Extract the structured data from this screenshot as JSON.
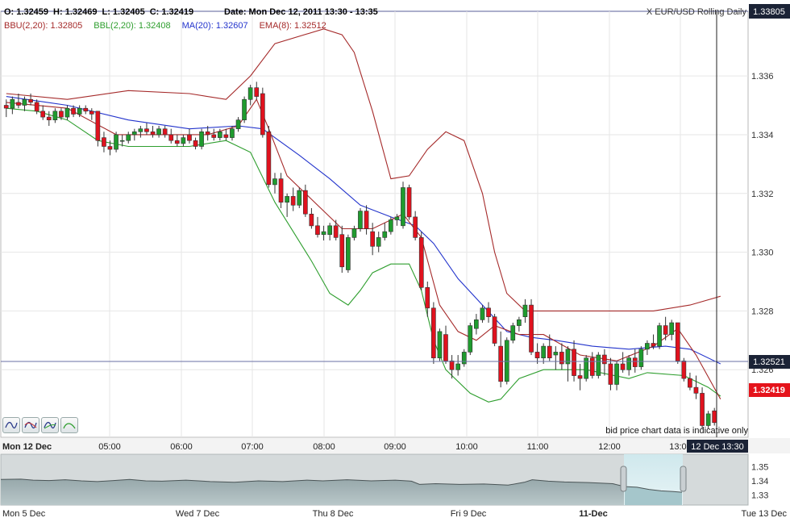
{
  "header": {
    "ohlc": [
      {
        "key": "O:",
        "value": "1.32459"
      },
      {
        "key": "H:",
        "value": "1.32469"
      },
      {
        "key": "L:",
        "value": "1.32405"
      },
      {
        "key": "C:",
        "value": "1.32419"
      }
    ],
    "date_label": "Date: Mon Dec 12, 2011 13:30 - 13:35",
    "instrument": "X EUR/USD Rolling Daily",
    "top_price": "1.33805"
  },
  "indicators": [
    {
      "label": "BBU(2,20): 1.32805",
      "color": "#a52a2a"
    },
    {
      "label": "BBL(2,20): 1.32408",
      "color": "#2e9e2e"
    },
    {
      "label": "MA(20): 1.32607",
      "color": "#2233cc"
    },
    {
      "label": "EMA(8): 1.32512",
      "color": "#a52a2a"
    }
  ],
  "cursor_price": "1.32521",
  "last_price": "1.32419",
  "cursor_time": "12 Dec 13:30",
  "disclaimer": "bid price chart data is indicative only",
  "toolbar": [
    {
      "name": "line-style-icon"
    },
    {
      "name": "bollinger-style-icon"
    },
    {
      "name": "ma-style-icon"
    },
    {
      "name": "ema-style-icon"
    }
  ],
  "chart_data": {
    "type": "candlestick",
    "ylim": [
      1.3237,
      1.3382
    ],
    "yticks": [
      "1.326",
      "1.328",
      "1.330",
      "1.332",
      "1.334",
      "1.336"
    ],
    "ytick_values": [
      1.326,
      1.328,
      1.33,
      1.332,
      1.334,
      1.336
    ],
    "xaxis_labels": [
      "Mon 12 Dec",
      "05:00",
      "06:00",
      "07:00",
      "08:00",
      "09:00",
      "10:00",
      "11:00",
      "12:00",
      "13:00"
    ],
    "candles": [
      [
        1.335,
        1.3352,
        1.3346,
        1.3349
      ],
      [
        1.3349,
        1.3353,
        1.3347,
        1.3352
      ],
      [
        1.3351,
        1.3354,
        1.3349,
        1.335
      ],
      [
        1.335,
        1.3353,
        1.3348,
        1.3352
      ],
      [
        1.3352,
        1.3354,
        1.335,
        1.3351
      ],
      [
        1.3351,
        1.3352,
        1.3347,
        1.3348
      ],
      [
        1.3348,
        1.335,
        1.3345,
        1.3346
      ],
      [
        1.3346,
        1.3348,
        1.3343,
        1.3345
      ],
      [
        1.3345,
        1.3349,
        1.3344,
        1.3348
      ],
      [
        1.3348,
        1.3349,
        1.3345,
        1.3346
      ],
      [
        1.3346,
        1.335,
        1.3345,
        1.3349
      ],
      [
        1.3349,
        1.335,
        1.3346,
        1.3347
      ],
      [
        1.3347,
        1.335,
        1.3346,
        1.3349
      ],
      [
        1.3349,
        1.335,
        1.3347,
        1.3348
      ],
      [
        1.3348,
        1.3349,
        1.3345,
        1.3347
      ],
      [
        1.3348,
        1.3348,
        1.3336,
        1.3338
      ],
      [
        1.3339,
        1.3341,
        1.3334,
        1.3336
      ],
      [
        1.3336,
        1.3338,
        1.3333,
        1.3335
      ],
      [
        1.3335,
        1.3341,
        1.3334,
        1.334
      ],
      [
        1.3338,
        1.334,
        1.3336,
        1.3338
      ],
      [
        1.3338,
        1.3341,
        1.3337,
        1.334
      ],
      [
        1.334,
        1.3342,
        1.3338,
        1.3341
      ],
      [
        1.3341,
        1.3343,
        1.3339,
        1.3342
      ],
      [
        1.3342,
        1.3344,
        1.334,
        1.3341
      ],
      [
        1.3341,
        1.3343,
        1.3339,
        1.334
      ],
      [
        1.334,
        1.3343,
        1.3339,
        1.3342
      ],
      [
        1.3342,
        1.3343,
        1.3339,
        1.334
      ],
      [
        1.334,
        1.3342,
        1.3337,
        1.3338
      ],
      [
        1.3338,
        1.334,
        1.3336,
        1.3337
      ],
      [
        1.3337,
        1.334,
        1.3336,
        1.3339
      ],
      [
        1.334,
        1.3342,
        1.3337,
        1.3338
      ],
      [
        1.3338,
        1.3339,
        1.3335,
        1.3336
      ],
      [
        1.3336,
        1.3342,
        1.3335,
        1.3341
      ],
      [
        1.3341,
        1.3343,
        1.3338,
        1.334
      ],
      [
        1.334,
        1.3342,
        1.3338,
        1.3339
      ],
      [
        1.3339,
        1.3342,
        1.3338,
        1.3341
      ],
      [
        1.334,
        1.3342,
        1.3338,
        1.3339
      ],
      [
        1.3339,
        1.3343,
        1.3338,
        1.3342
      ],
      [
        1.3342,
        1.3346,
        1.3341,
        1.3345
      ],
      [
        1.3345,
        1.3353,
        1.3344,
        1.3352
      ],
      [
        1.3352,
        1.3357,
        1.335,
        1.3356
      ],
      [
        1.3356,
        1.3358,
        1.3352,
        1.3353
      ],
      [
        1.3354,
        1.3356,
        1.3339,
        1.334
      ],
      [
        1.3341,
        1.3343,
        1.3322,
        1.3323
      ],
      [
        1.3323,
        1.3327,
        1.332,
        1.3325
      ],
      [
        1.3325,
        1.3327,
        1.3315,
        1.3317
      ],
      [
        1.3317,
        1.332,
        1.3312,
        1.3319
      ],
      [
        1.3319,
        1.3322,
        1.3314,
        1.3316
      ],
      [
        1.3316,
        1.3322,
        1.3315,
        1.3321
      ],
      [
        1.3321,
        1.3323,
        1.3312,
        1.3313
      ],
      [
        1.3313,
        1.3315,
        1.3308,
        1.3309
      ],
      [
        1.3309,
        1.3312,
        1.3305,
        1.3306
      ],
      [
        1.3306,
        1.3309,
        1.3304,
        1.3307
      ],
      [
        1.3306,
        1.331,
        1.3304,
        1.3309
      ],
      [
        1.3309,
        1.3311,
        1.3304,
        1.3305
      ],
      [
        1.3306,
        1.3309,
        1.3293,
        1.3295
      ],
      [
        1.3294,
        1.3306,
        1.3293,
        1.3305
      ],
      [
        1.3305,
        1.3309,
        1.3304,
        1.3308
      ],
      [
        1.3308,
        1.3315,
        1.3307,
        1.3314
      ],
      [
        1.3314,
        1.3316,
        1.3306,
        1.3308
      ],
      [
        1.3307,
        1.331,
        1.3299,
        1.3302
      ],
      [
        1.3302,
        1.3307,
        1.33,
        1.3305
      ],
      [
        1.3305,
        1.331,
        1.3304,
        1.3307
      ],
      [
        1.3307,
        1.3312,
        1.3306,
        1.3311
      ],
      [
        1.3311,
        1.3313,
        1.3309,
        1.3312
      ],
      [
        1.3309,
        1.3324,
        1.3308,
        1.3322
      ],
      [
        1.3322,
        1.3323,
        1.3311,
        1.3312
      ],
      [
        1.3312,
        1.3314,
        1.3304,
        1.3305
      ],
      [
        1.3305,
        1.3307,
        1.3287,
        1.3288
      ],
      [
        1.3288,
        1.329,
        1.3278,
        1.3281
      ],
      [
        1.3281,
        1.3283,
        1.3262,
        1.3264
      ],
      [
        1.3264,
        1.3274,
        1.3263,
        1.3273
      ],
      [
        1.3272,
        1.3275,
        1.3262,
        1.3263
      ],
      [
        1.3263,
        1.3265,
        1.3257,
        1.326
      ],
      [
        1.326,
        1.3265,
        1.3258,
        1.3262
      ],
      [
        1.3262,
        1.3267,
        1.3261,
        1.3266
      ],
      [
        1.3266,
        1.3276,
        1.3265,
        1.3275
      ],
      [
        1.3274,
        1.3279,
        1.3272,
        1.3277
      ],
      [
        1.3277,
        1.3282,
        1.3276,
        1.3281
      ],
      [
        1.3281,
        1.3283,
        1.3276,
        1.3278
      ],
      [
        1.3278,
        1.3279,
        1.3268,
        1.3269
      ],
      [
        1.3268,
        1.3273,
        1.3254,
        1.3256
      ],
      [
        1.3256,
        1.3271,
        1.3255,
        1.327
      ],
      [
        1.327,
        1.3276,
        1.3269,
        1.3275
      ],
      [
        1.3275,
        1.3278,
        1.3273,
        1.3277
      ],
      [
        1.3278,
        1.3284,
        1.3276,
        1.3282
      ],
      [
        1.3282,
        1.3284,
        1.3265,
        1.3266
      ],
      [
        1.3266,
        1.3269,
        1.3262,
        1.3264
      ],
      [
        1.3264,
        1.3269,
        1.3262,
        1.3268
      ],
      [
        1.3268,
        1.3272,
        1.3263,
        1.3264
      ],
      [
        1.3265,
        1.3268,
        1.326,
        1.3266
      ],
      [
        1.3266,
        1.3269,
        1.326,
        1.3262
      ],
      [
        1.3262,
        1.3268,
        1.3256,
        1.3267
      ],
      [
        1.3267,
        1.327,
        1.3256,
        1.3258
      ],
      [
        1.3258,
        1.3262,
        1.3253,
        1.3257
      ],
      [
        1.3257,
        1.3265,
        1.3256,
        1.3264
      ],
      [
        1.3264,
        1.3266,
        1.3257,
        1.3258
      ],
      [
        1.3258,
        1.3266,
        1.3257,
        1.3265
      ],
      [
        1.3265,
        1.3267,
        1.3258,
        1.3262
      ],
      [
        1.3262,
        1.3264,
        1.3253,
        1.3255
      ],
      [
        1.3255,
        1.3263,
        1.3253,
        1.3262
      ],
      [
        1.3262,
        1.3266,
        1.3259,
        1.326
      ],
      [
        1.326,
        1.3265,
        1.3258,
        1.3264
      ],
      [
        1.3264,
        1.3267,
        1.3259,
        1.3261
      ],
      [
        1.3261,
        1.3268,
        1.326,
        1.3267
      ],
      [
        1.3267,
        1.327,
        1.3265,
        1.3269
      ],
      [
        1.3269,
        1.3272,
        1.3267,
        1.3268
      ],
      [
        1.3268,
        1.3276,
        1.3267,
        1.3275
      ],
      [
        1.3275,
        1.3278,
        1.327,
        1.3272
      ],
      [
        1.3272,
        1.3277,
        1.327,
        1.3276
      ],
      [
        1.3276,
        1.3276,
        1.3262,
        1.3263
      ],
      [
        1.3263,
        1.3264,
        1.3256,
        1.3257
      ],
      [
        1.3257,
        1.3259,
        1.3253,
        1.3254
      ],
      [
        1.3254,
        1.3258,
        1.325,
        1.3252
      ],
      [
        1.3252,
        1.3254,
        1.324,
        1.3241
      ],
      [
        1.3241,
        1.3246,
        1.324,
        1.3245
      ],
      [
        1.3246,
        1.3247,
        1.3241,
        1.3242
      ]
    ],
    "bbu": [
      [
        0,
        1.3354
      ],
      [
        10,
        1.3352
      ],
      [
        20,
        1.3355
      ],
      [
        30,
        1.3354
      ],
      [
        36,
        1.3352
      ],
      [
        40,
        1.336
      ],
      [
        44,
        1.3371
      ],
      [
        52,
        1.3376
      ],
      [
        55,
        1.3374
      ],
      [
        57,
        1.3368
      ],
      [
        60,
        1.3348
      ],
      [
        63,
        1.3325
      ],
      [
        66,
        1.3326
      ],
      [
        69,
        1.3335
      ],
      [
        72,
        1.3341
      ],
      [
        75,
        1.3338
      ],
      [
        78,
        1.332
      ],
      [
        80,
        1.33
      ],
      [
        82,
        1.3286
      ],
      [
        85,
        1.328
      ],
      [
        88,
        1.328
      ],
      [
        92,
        1.328
      ],
      [
        100,
        1.328
      ],
      [
        106,
        1.328
      ],
      [
        112,
        1.3282
      ],
      [
        117,
        1.3285
      ]
    ],
    "bbl": [
      [
        0,
        1.3349
      ],
      [
        5,
        1.3348
      ],
      [
        10,
        1.3345
      ],
      [
        15,
        1.3338
      ],
      [
        20,
        1.3336
      ],
      [
        30,
        1.3336
      ],
      [
        36,
        1.3338
      ],
      [
        40,
        1.3334
      ],
      [
        44,
        1.3317
      ],
      [
        47,
        1.3307
      ],
      [
        50,
        1.3297
      ],
      [
        53,
        1.3286
      ],
      [
        56,
        1.3282
      ],
      [
        58,
        1.3287
      ],
      [
        60,
        1.3293
      ],
      [
        63,
        1.3296
      ],
      [
        66,
        1.3296
      ],
      [
        68,
        1.3287
      ],
      [
        70,
        1.327
      ],
      [
        72,
        1.326
      ],
      [
        76,
        1.3252
      ],
      [
        79,
        1.3249
      ],
      [
        81,
        1.325
      ],
      [
        84,
        1.3257
      ],
      [
        88,
        1.326
      ],
      [
        95,
        1.326
      ],
      [
        102,
        1.3257
      ],
      [
        105,
        1.3259
      ],
      [
        111,
        1.3258
      ],
      [
        115,
        1.3254
      ],
      [
        117,
        1.3251
      ]
    ],
    "ma20": [
      [
        0,
        1.3353
      ],
      [
        10,
        1.335
      ],
      [
        20,
        1.3345
      ],
      [
        30,
        1.3342
      ],
      [
        38,
        1.3343
      ],
      [
        42,
        1.3342
      ],
      [
        48,
        1.3333
      ],
      [
        53,
        1.3325
      ],
      [
        58,
        1.3316
      ],
      [
        63,
        1.3312
      ],
      [
        67,
        1.3309
      ],
      [
        70,
        1.3303
      ],
      [
        74,
        1.3291
      ],
      [
        78,
        1.3282
      ],
      [
        82,
        1.3273
      ],
      [
        86,
        1.3271
      ],
      [
        90,
        1.327
      ],
      [
        96,
        1.3268
      ],
      [
        102,
        1.3267
      ],
      [
        108,
        1.3268
      ],
      [
        112,
        1.3267
      ],
      [
        117,
        1.3262
      ]
    ],
    "ema8": [
      [
        0,
        1.3351
      ],
      [
        10,
        1.3349
      ],
      [
        18,
        1.334
      ],
      [
        25,
        1.334
      ],
      [
        33,
        1.334
      ],
      [
        38,
        1.3343
      ],
      [
        41,
        1.3352
      ],
      [
        43,
        1.3342
      ],
      [
        46,
        1.3326
      ],
      [
        50,
        1.3318
      ],
      [
        55,
        1.3308
      ],
      [
        60,
        1.3308
      ],
      [
        65,
        1.3313
      ],
      [
        68,
        1.3305
      ],
      [
        71,
        1.3282
      ],
      [
        74,
        1.3273
      ],
      [
        77,
        1.327
      ],
      [
        80,
        1.3275
      ],
      [
        84,
        1.3272
      ],
      [
        88,
        1.3272
      ],
      [
        94,
        1.3265
      ],
      [
        100,
        1.3263
      ],
      [
        106,
        1.3268
      ],
      [
        110,
        1.3274
      ],
      [
        113,
        1.3265
      ],
      [
        117,
        1.325
      ]
    ],
    "overview": {
      "ylim": [
        1.323,
        1.357
      ],
      "yticks": [
        "1.35",
        "1.34",
        "1.33"
      ],
      "ytick_values": [
        1.35,
        1.34,
        1.33
      ],
      "xaxis_labels": [
        "Mon 5 Dec",
        "Wed 7 Dec",
        "Thu 8 Dec",
        "Fri 9 Dec",
        "11-Dec",
        "Tue 13 Dec"
      ],
      "series": [
        [
          0,
          1.341
        ],
        [
          25,
          1.3412
        ],
        [
          40,
          1.3405
        ],
        [
          60,
          1.3402
        ],
        [
          80,
          1.3408
        ],
        [
          100,
          1.34
        ],
        [
          120,
          1.3395
        ],
        [
          140,
          1.3402
        ],
        [
          160,
          1.341
        ],
        [
          180,
          1.34
        ],
        [
          200,
          1.3398
        ],
        [
          230,
          1.3405
        ],
        [
          260,
          1.3395
        ],
        [
          290,
          1.339
        ],
        [
          320,
          1.34
        ],
        [
          350,
          1.3395
        ],
        [
          380,
          1.3405
        ],
        [
          400,
          1.34
        ],
        [
          430,
          1.3408
        ],
        [
          460,
          1.34
        ],
        [
          490,
          1.3405
        ],
        [
          510,
          1.3398
        ],
        [
          520,
          1.3375
        ],
        [
          540,
          1.338
        ],
        [
          570,
          1.3375
        ],
        [
          600,
          1.3378
        ],
        [
          630,
          1.337
        ],
        [
          650,
          1.339
        ],
        [
          660,
          1.3408
        ],
        [
          680,
          1.3398
        ],
        [
          700,
          1.3392
        ],
        [
          730,
          1.3388
        ],
        [
          760,
          1.338
        ],
        [
          775,
          1.336
        ],
        [
          790,
          1.3355
        ],
        [
          805,
          1.334
        ],
        [
          820,
          1.333
        ],
        [
          835,
          1.3325
        ],
        [
          846,
          1.332
        ]
      ]
    }
  }
}
